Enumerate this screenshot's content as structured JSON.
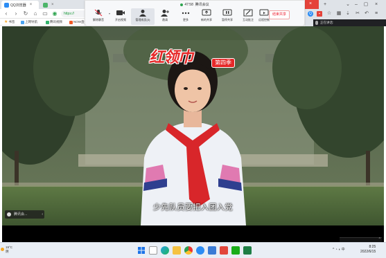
{
  "browser": {
    "tabs": [
      {
        "label": "QQ浏览器"
      },
      {
        "label": "https://"
      }
    ],
    "address": "https://",
    "bookmarks": [
      "书签",
      "上网导航",
      "腾讯视频",
      "NOW直播"
    ]
  },
  "meeting": {
    "time": "47:58",
    "title": "腾讯会议",
    "tools": [
      {
        "label": "解除静音"
      },
      {
        "label": "开启视频"
      },
      {
        "label": "管理成员(3)"
      },
      {
        "label": "邀请"
      },
      {
        "label": "更多"
      },
      {
        "label": "新的共享"
      },
      {
        "label": "暂停共享"
      },
      {
        "label": "互动批注"
      },
      {
        "label": "远程控制"
      }
    ],
    "end_share": "结束共享",
    "speaking": "正在讲话:"
  },
  "video": {
    "logo": "红领巾",
    "season": "第四季",
    "subtitle": "少先队员要把入团入党",
    "chip": "腾讯会..."
  },
  "taskbar": {
    "weather_temp": "19°C",
    "weather_desc": "阴",
    "time": "8:25",
    "date": "2022/6/15"
  },
  "colors": {
    "accent_red": "#e62828",
    "end_share_border": "#f0a3a3",
    "scarf": "#d8262a"
  }
}
